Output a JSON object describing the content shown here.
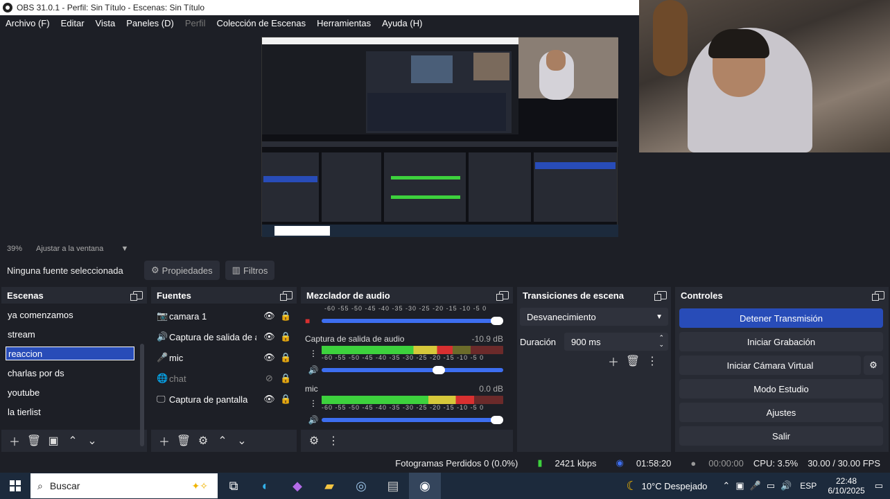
{
  "window": {
    "title": "OBS 31.0.1 - Perfil: Sin Título - Escenas: Sin Título"
  },
  "menu": [
    "Archivo (F)",
    "Editar",
    "Vista",
    "Paneles (D)",
    "Perfil",
    "Colección de Escenas",
    "Herramientas",
    "Ayuda (H)"
  ],
  "preview": {
    "zoom": "39%",
    "fit_label": "Ajustar a la ventana"
  },
  "source_toolbar": {
    "no_selection": "Ninguna fuente seleccionada",
    "properties": "Propiedades",
    "filters": "Filtros"
  },
  "scenes": {
    "title": "Escenas",
    "items": [
      "ya comenzamos",
      "stream",
      "reaccion",
      "charlas por ds",
      "youtube",
      "la tierlist"
    ],
    "selected": "reaccion"
  },
  "sources": {
    "title": "Fuentes",
    "items": [
      {
        "name": "camara 1",
        "icon": "camera-icon"
      },
      {
        "name": "Captura de salida de audio",
        "icon": "speaker-icon"
      },
      {
        "name": "mic",
        "icon": "microphone-icon"
      },
      {
        "name": "chat",
        "icon": "browser-icon"
      },
      {
        "name": "Captura de pantalla",
        "icon": "monitor-icon"
      }
    ]
  },
  "mixer": {
    "title": "Mezclador de audio",
    "ticks": "-60 -55 -50 -45 -40 -35 -30 -25 -20 -15 -10 -5 0",
    "channels": [
      {
        "name": "Captura de salida de audio",
        "db": "-10.9 dB",
        "level": 0.72,
        "volume": 0.68
      },
      {
        "name": "mic",
        "db": "0.0 dB",
        "level": 0.84,
        "volume": 1.0
      }
    ]
  },
  "transitions": {
    "title": "Transiciones de escena",
    "selected": "Desvanecimiento",
    "duration_label": "Duración",
    "duration_value": "900 ms"
  },
  "controls": {
    "title": "Controles",
    "stop_stream": "Detener Transmisión",
    "start_recording": "Iniciar Grabación",
    "start_virtual_cam": "Iniciar Cámara Virtual",
    "studio_mode": "Modo Estudio",
    "settings": "Ajustes",
    "exit": "Salir"
  },
  "status": {
    "dropped_frames": "Fotogramas Perdidos 0 (0.0%)",
    "bitrate": "2421 kbps",
    "stream_time": "01:58:20",
    "rec_time": "00:00:00",
    "cpu": "CPU: 3.5%",
    "fps": "30.00 / 30.00 FPS"
  },
  "taskbar": {
    "search": "Buscar",
    "weather": "10°C  Despejado",
    "lang": "ESP",
    "time": "22:48",
    "date": "6/10/2025"
  },
  "colors": {
    "accent": "#284cb8",
    "panel": "#272a33",
    "background": "#1d1f26"
  }
}
